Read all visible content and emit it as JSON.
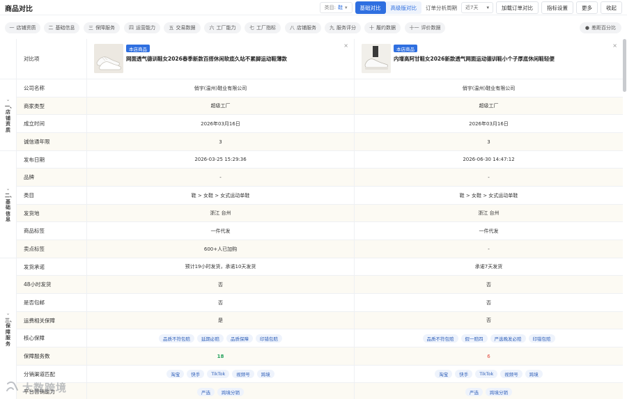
{
  "header": {
    "title": "商品对比",
    "category_label": "类目:",
    "category_value": "鞋",
    "seg_basic": "基础对比",
    "seg_advanced": "高级版对比",
    "period_label": "订单分析周期",
    "period_value": "近7天",
    "buttons": [
      "加载订单对比",
      "指标设置",
      "更多",
      "收起"
    ]
  },
  "tabs": [
    {
      "icon": "一",
      "label": "店铺资质"
    },
    {
      "icon": "二",
      "label": "基础信息"
    },
    {
      "icon": "三",
      "label": "保障服务"
    },
    {
      "icon": "四",
      "label": "运营能力"
    },
    {
      "icon": "五",
      "label": "交易数据"
    },
    {
      "icon": "六",
      "label": "工厂能力"
    },
    {
      "icon": "七",
      "label": "工厂指标"
    },
    {
      "icon": "八",
      "label": "店铺服务"
    },
    {
      "icon": "九",
      "label": "服务评分"
    },
    {
      "icon": "十",
      "label": "履约数据"
    },
    {
      "icon": "十一",
      "label": "评价数据"
    }
  ],
  "reset_label": "差距百分比",
  "compare_label": "对比项",
  "products": [
    {
      "badge": "本店商品",
      "title": "网面透气德训鞋女2026春季新款百搭休闲软底久站不累脚运动鞋薄款"
    },
    {
      "badge": "本店商品",
      "title": "内增高阿甘鞋女2026新款透气网面运动德训鞋小个子厚底休闲鞋轻便"
    }
  ],
  "groups": [
    {
      "label": "一、店铺资质"
    },
    {
      "label": "二、基础信息"
    },
    {
      "label": "三、保障服务"
    }
  ],
  "rows": [
    {
      "label": "公司名称",
      "v1": "俏宇(温州)鞋业有限公司",
      "v2": "俏宇(温州)鞋业有限公司"
    },
    {
      "label": "商家类型",
      "v1": "超级工厂",
      "v2": "超级工厂"
    },
    {
      "label": "成立时间",
      "v1": "2026年03月16日",
      "v2": "2026年03月16日"
    },
    {
      "label": "诚信通年限",
      "v1": "3",
      "v2": "3"
    },
    {
      "label": "发布日期",
      "v1": "2026-03-25 15:29:36",
      "v2": "2026-06-30 14:47:12"
    },
    {
      "label": "品牌",
      "v1": "-",
      "v2": "-"
    },
    {
      "label": "类目",
      "v1": "鞋 > 女鞋 > 女式运动单鞋",
      "v2": "鞋 > 女鞋 > 女式运动单鞋"
    },
    {
      "label": "发货地",
      "v1": "浙江 台州",
      "v2": "浙江 台州"
    },
    {
      "label": "商品标签",
      "v1": "一件代发",
      "v2": "一件代发"
    },
    {
      "label": "卖点标签",
      "v1": "600+人已加购",
      "v2": "-"
    },
    {
      "label": "发货承诺",
      "v1": "预计19小时发货，承诺10天发货",
      "v2": "承诺7天发货"
    },
    {
      "label": "48小时发货",
      "v1": "否",
      "v2": "否"
    },
    {
      "label": "是否包邮",
      "v1": "否",
      "v2": "否"
    },
    {
      "label": "运费相关保障",
      "v1": "是",
      "v2": "否"
    },
    {
      "label": "核心保障",
      "tags1": [
        "品质不符包赔",
        "延期必赔",
        "品质保障",
        "印错包赔"
      ],
      "tags2": [
        "品质不符包赔",
        "假一赔四",
        "严选晚发必赔",
        "印错包赔"
      ]
    },
    {
      "label": "保障服务数",
      "v1": "18",
      "v2": "6"
    },
    {
      "label": "分销渠道匹配",
      "tags1": [
        "淘宝",
        "快手",
        "TikTok",
        "视频号",
        "跨境"
      ],
      "tags2": [
        "淘宝",
        "快手",
        "TikTok",
        "视频号",
        "跨境"
      ]
    },
    {
      "label": "平台营销能力",
      "tags1": [
        "严选",
        "跨境分销"
      ],
      "tags2": [
        "严选",
        "跨境分销"
      ]
    }
  ],
  "watermark": "大数跨境"
}
